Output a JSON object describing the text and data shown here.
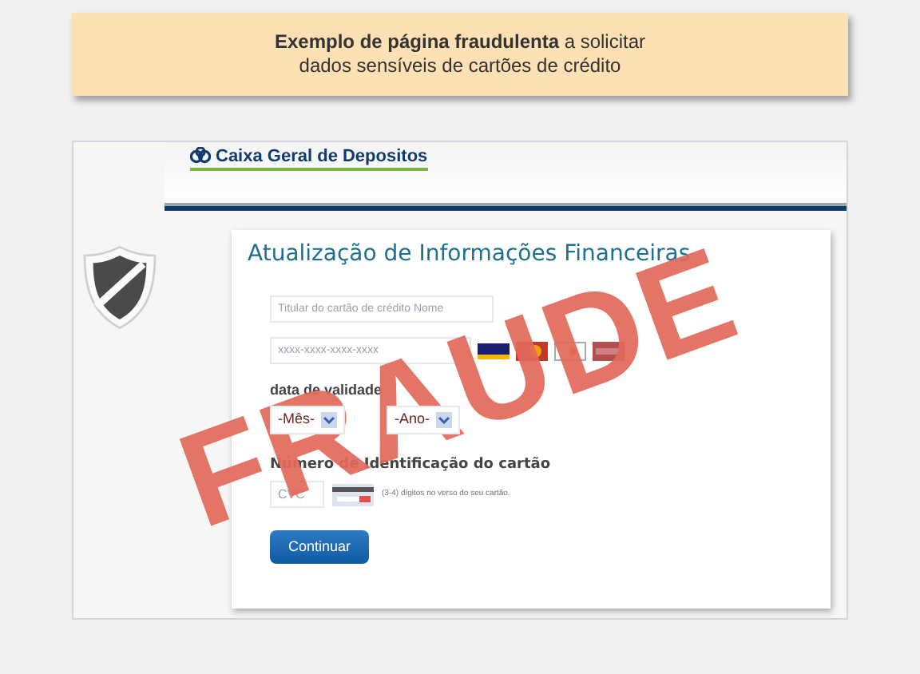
{
  "banner": {
    "text": "**Exemplo de página fraudulenta** a solicitar\ndados sensíveis de cartões de crédito"
  },
  "site": {
    "logo": "Caixa Geral de Depositos"
  },
  "form": {
    "title": "Atualização de Informações Financeiras",
    "name_field": {
      "placeholder": "Titular do cartão de crédito Nome"
    },
    "number_field": {
      "placeholder": "xxxx-xxxx-xxxx-xxxx"
    },
    "expiry_label": "data de validade",
    "month_select": {
      "value": "-Mês-"
    },
    "year_select": {
      "value": "-Ano-"
    },
    "cvc_label": "Número de Identificação do cartão",
    "cvc_field": {
      "placeholder": "CVC"
    },
    "cvc_hint": "(3-4) dígitos no verso do seu cartão.",
    "submit": "Continuar"
  },
  "stamp": {
    "text": "FRAUDE"
  }
}
